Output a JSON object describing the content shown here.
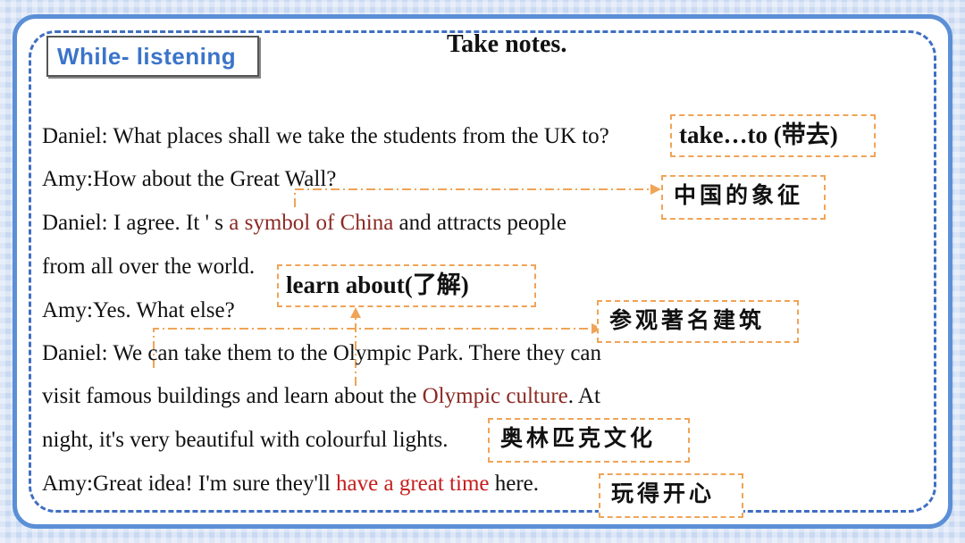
{
  "section_label": "While- listening",
  "title": "Take notes.",
  "dialogue": {
    "line1": "Daniel: What places shall we take the students from the UK to?",
    "line2": "Amy:How about the Great Wall?",
    "line3_pre": "Daniel: I agree. It ' s ",
    "line3_hl": "a symbol of China",
    "line3_post": " and attracts people",
    "line4": "from all over the world.",
    "line5": "Amy:Yes. What else?",
    "line6": "Daniel: We can take them to the Olympic Park. There they can",
    "line7_pre": "visit famous buildings and learn about the ",
    "line7_hl": "Olympic culture",
    "line7_post": ". At",
    "line8": "night, it's very beautiful with colourful lights.",
    "line9_pre": "Amy:Great idea! I'm sure they'll ",
    "line9_hl": "have a great time",
    "line9_post": " here."
  },
  "notes": {
    "take_to": "take…to (带去)",
    "symbol": "中国的象征",
    "learn_about": "learn about(了解)",
    "visit": "参观著名建筑",
    "olympic": "奥林匹克文化",
    "great_time": "玩得开心"
  },
  "colors": {
    "panel_border": "#5b8fd6",
    "dash_border": "#3f6fc2",
    "note_border": "#f0a457",
    "highlight_brown": "#8b2a24",
    "highlight_red": "#c61d1d",
    "label_text": "#3b74c9"
  }
}
